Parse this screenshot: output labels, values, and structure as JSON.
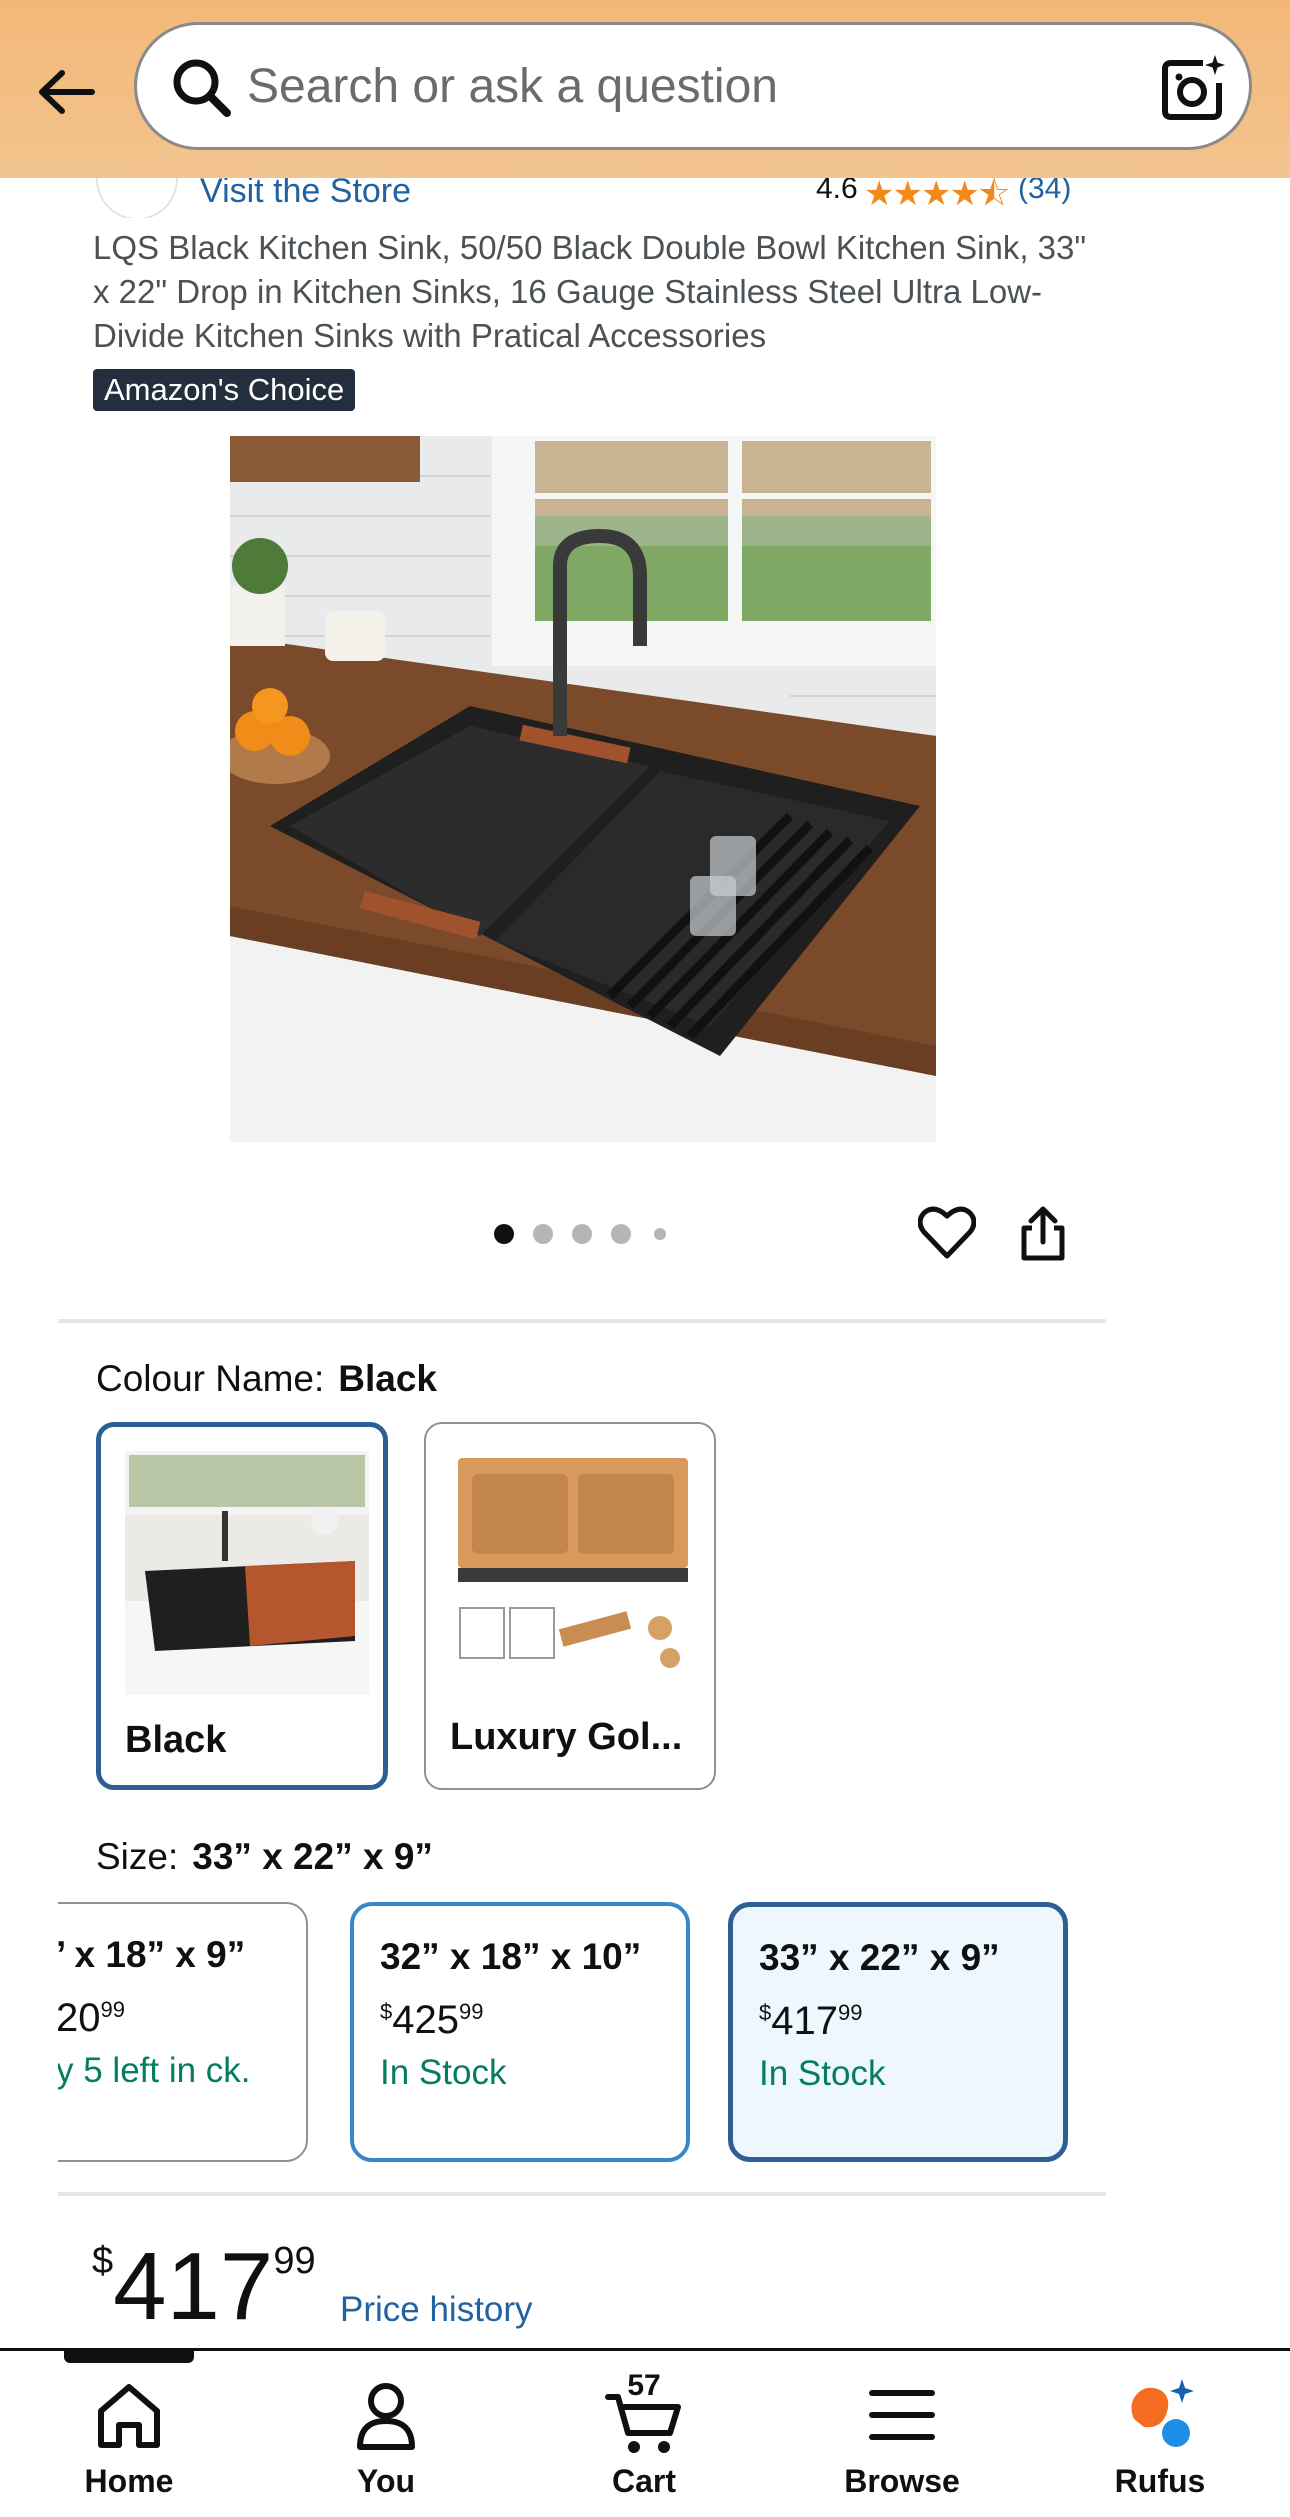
{
  "header": {
    "search_placeholder": "Search or ask a question",
    "icons": {
      "back": "back-arrow-icon",
      "search": "search-icon",
      "camera": "camera-lens-icon"
    }
  },
  "store": {
    "visit_label": "Visit the Store",
    "rating": "4.6",
    "stars": "★★★★⯪",
    "rating_count": "(34)"
  },
  "product": {
    "title": "LQS Black Kitchen Sink, 50/50 Black Double Bowl Kitchen Sink, 33\" x 22\" Drop in Kitchen Sinks, 16 Gauge Stainless Steel Ultra Low-Divide Kitchen Sinks with Pratical Accessories",
    "badge": "Amazon's Choice",
    "image_count": 5,
    "active_image": 1
  },
  "colour": {
    "label": "Colour Name:",
    "selected": "Black",
    "options": [
      {
        "name": "Black",
        "selected": true
      },
      {
        "name": "Luxury Gol...",
        "selected": false
      }
    ]
  },
  "size": {
    "label": "Size:",
    "selected": "33” x 22” x 9”",
    "options": [
      {
        "dim": "’ x 18” x 9”",
        "price_whole": "20",
        "price_cents": "99",
        "stock": "y 5 left in ck."
      },
      {
        "dim": "32” x 18” x 10”",
        "price_currency": "$",
        "price_whole": "425",
        "price_cents": "99",
        "stock": "In Stock"
      },
      {
        "dim": "33” x 22” x 9”",
        "price_currency": "$",
        "price_whole": "417",
        "price_cents": "99",
        "stock": "In Stock"
      }
    ]
  },
  "price": {
    "currency": "$",
    "whole": "417",
    "cents": "99",
    "history_link": "Price history"
  },
  "nav": {
    "home": "Home",
    "you": "You",
    "cart": "Cart",
    "cart_count": "57",
    "browse": "Browse",
    "rufus": "Rufus"
  },
  "colors": {
    "header_bg": "#f3b877",
    "link": "#2162a1",
    "stock_green": "#067d62",
    "selected_border": "#2d5f94",
    "star": "#f18a1a"
  }
}
